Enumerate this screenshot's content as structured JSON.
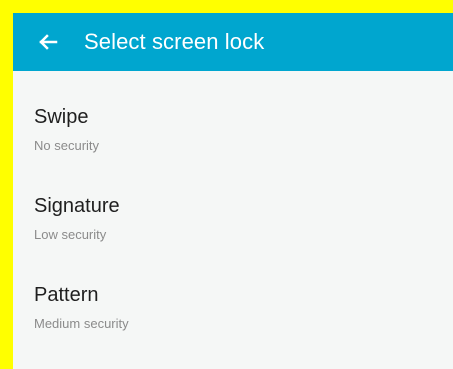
{
  "header": {
    "title": "Select screen lock",
    "back_icon": "arrow-left-icon",
    "background_color": "#00a6cf"
  },
  "options": [
    {
      "title": "Swipe",
      "security": "No security"
    },
    {
      "title": "Signature",
      "security": "Low security"
    },
    {
      "title": "Pattern",
      "security": "Medium security"
    }
  ],
  "screen": {
    "background_color": "#f5f7f6",
    "border_color": "#ffff00"
  }
}
